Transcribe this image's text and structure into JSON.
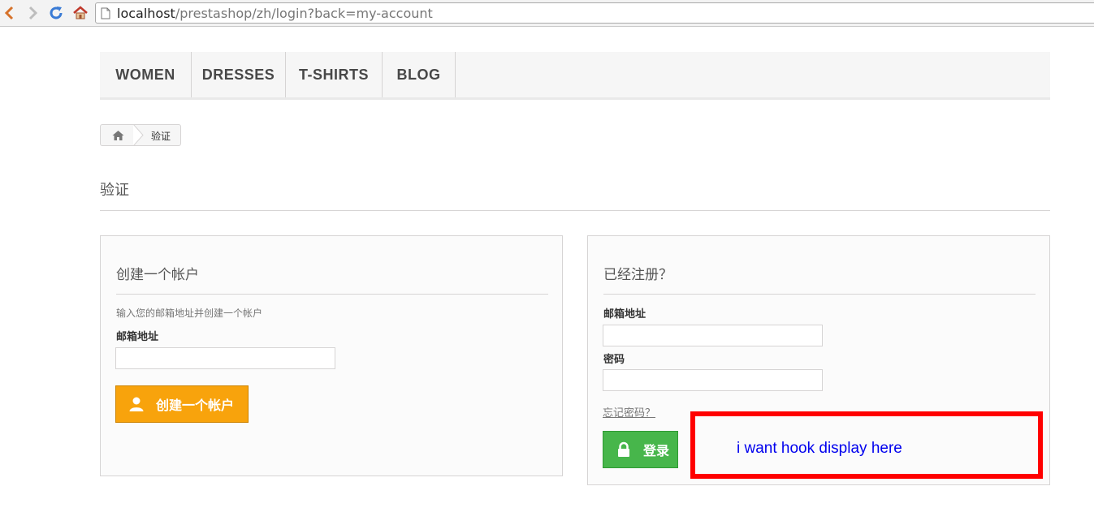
{
  "browser": {
    "url_host": "localhost",
    "url_path": "/prestashop/zh/login?back=my-account"
  },
  "menu": {
    "items": [
      {
        "label": "WOMEN"
      },
      {
        "label": "DRESSES"
      },
      {
        "label": "T-SHIRTS"
      },
      {
        "label": "BLOG"
      }
    ]
  },
  "breadcrumb": {
    "current": "验证"
  },
  "page": {
    "heading": "验证"
  },
  "create_account": {
    "title": "创建一个帐户",
    "hint": "输入您的邮箱地址并创建一个帐户",
    "email_label": "邮箱地址",
    "email_value": "",
    "button_label": "创建一个帐户"
  },
  "login": {
    "title": "已经注册？",
    "email_label": "邮箱地址",
    "email_value": "",
    "password_label": "密码",
    "password_value": "",
    "forgot_link": "忘记密码？",
    "button_label": "登录"
  },
  "annotation": {
    "text": "i want hook display here"
  },
  "colors": {
    "create_button": "#f8a30c",
    "login_button": "#47b64b",
    "annotation_border": "#ff0000",
    "annotation_text": "#0000ee"
  }
}
